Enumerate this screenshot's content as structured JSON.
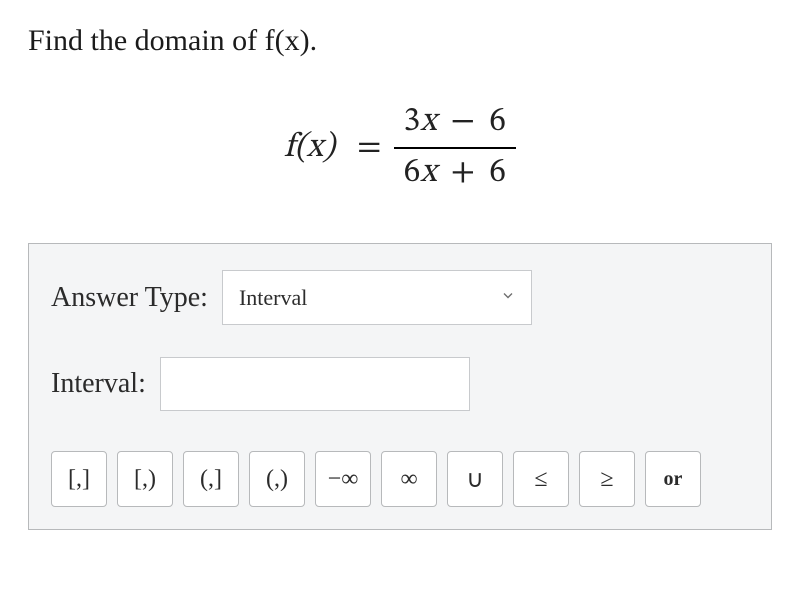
{
  "prompt": "Find the domain of f(x).",
  "formula": {
    "lhs": "f(x)",
    "numerator_parts": [
      "3",
      "x",
      " − ",
      "6"
    ],
    "denominator_parts": [
      "6",
      "x",
      " + ",
      "6"
    ]
  },
  "answer_area": {
    "type_label": "Answer Type:",
    "type_selected": "Interval",
    "type_options": [
      "Interval"
    ],
    "interval_label": "Interval:",
    "interval_value": "",
    "buttons": [
      {
        "label": "[,]",
        "name": "bracket-closed-closed"
      },
      {
        "label": "[,)",
        "name": "bracket-closed-open"
      },
      {
        "label": "(,]",
        "name": "bracket-open-closed"
      },
      {
        "label": "(,)",
        "name": "bracket-open-open"
      },
      {
        "label": "−∞",
        "name": "neg-infinity"
      },
      {
        "label": "∞",
        "name": "infinity"
      },
      {
        "label": "∪",
        "name": "union"
      },
      {
        "label": "≤",
        "name": "leq"
      },
      {
        "label": "≥",
        "name": "geq"
      },
      {
        "label": "or",
        "name": "or-text",
        "small": true
      }
    ]
  }
}
